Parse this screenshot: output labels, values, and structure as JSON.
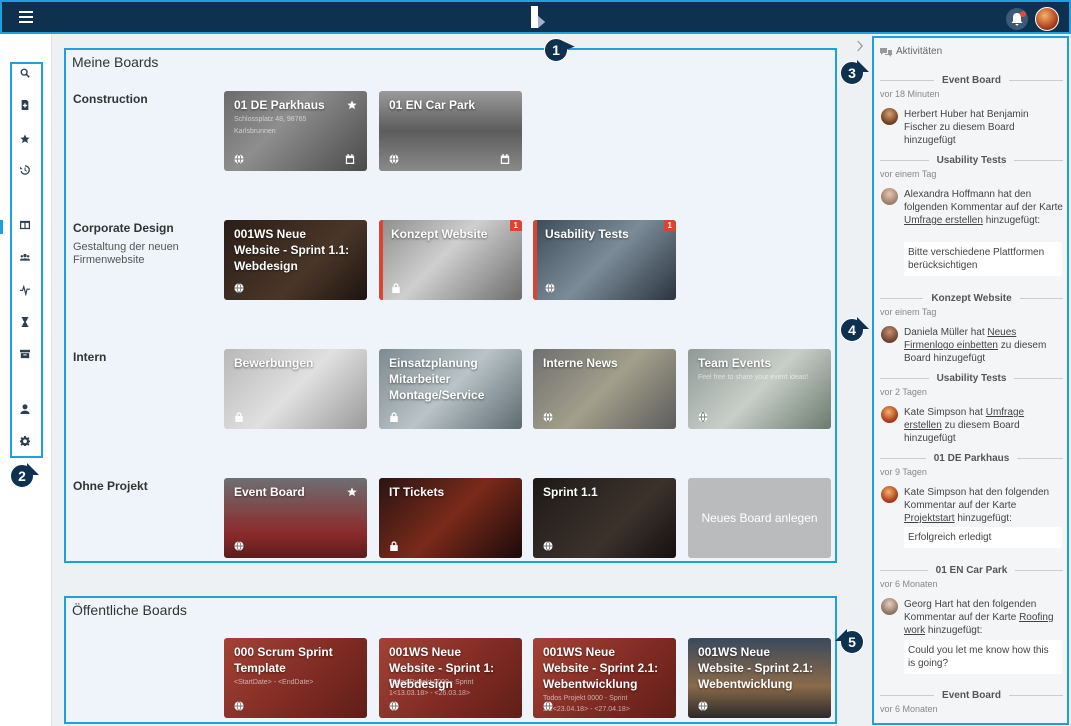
{
  "markers": [
    "1",
    "2",
    "3",
    "4",
    "5"
  ],
  "my_boards": {
    "title": "Meine Boards",
    "groups": [
      {
        "label": "Construction",
        "sub": ""
      },
      {
        "label": "Corporate Design",
        "sub": "Gestaltung der neuen Firmenwebsite"
      },
      {
        "label": "Intern",
        "sub": ""
      },
      {
        "label": "Ohne Projekt",
        "sub": ""
      }
    ],
    "cards": {
      "parkhaus": {
        "title": "01 DE Parkhaus",
        "sub1": "Schlossplatz 48, 98765",
        "sub2": "Karlsbrunnen"
      },
      "carpark": {
        "title": "01 EN Car Park"
      },
      "newsite": {
        "title": "001WS Neue Website - Sprint 1.1: Webdesign"
      },
      "konzept": {
        "title": "Konzept Website",
        "count": "1"
      },
      "usability": {
        "title": "Usability Tests",
        "count": "1"
      },
      "bewerbungen": {
        "title": "Bewerbungen"
      },
      "einsatz": {
        "title": "Einsatzplanung Mitarbeiter Montage/Service"
      },
      "news": {
        "title": "Interne News"
      },
      "team": {
        "title": "Team Events",
        "sub1": "Feel free to share your event ideas!"
      },
      "event": {
        "title": "Event Board"
      },
      "it": {
        "title": "IT Tickets"
      },
      "sprint": {
        "title": "Sprint 1.1"
      },
      "new_board": {
        "title": "Neues Board anlegen"
      }
    }
  },
  "public_boards": {
    "title": "Öffentliche Boards",
    "cards": {
      "scrum": {
        "title": "000 Scrum Sprint Template",
        "sub1": "<StartDate> - <EndDate>"
      },
      "ws1": {
        "title": "001WS Neue Website - Sprint 1: Webdesign",
        "sub1": "Todos Projekt 0000 - Sprint",
        "sub2": "1<13.03.18> - <26.03.18>"
      },
      "ws21a": {
        "title": "001WS Neue Website - Sprint 2.1: Webentwicklung",
        "sub1": "Todos Projekt 0000 - Sprint",
        "sub2": "2.1<23.04.18> - <27.04.18>"
      },
      "ws21b": {
        "title": "001WS Neue Website - Sprint 2.1: Webentwicklung"
      }
    }
  },
  "activities": {
    "title": "Aktivitäten",
    "entries": [
      {
        "board": "Event Board",
        "time": "vor 18 Minuten",
        "text": "Herbert Huber hat Benjamin Fischer zu diesem Board hinzugefügt"
      },
      {
        "board": "Usability Tests",
        "time": "vor einem Tag",
        "text_a": "Alexandra Hoffmann hat den folgenden Kommentar auf der Karte",
        "link": "Umfrage erstellen",
        "text_b": "hinzugefügt:",
        "quote": "Bitte verschiedene Plattformen berücksichtigen"
      },
      {
        "board": "Konzept Website",
        "time": "vor einem Tag",
        "text_a": "Daniela Müller hat",
        "link": "Neues Firmenlogo einbetten",
        "text_b": "zu diesem Board hinzugefügt"
      },
      {
        "board": "Usability Tests",
        "time": "vor 2 Tagen",
        "text_a": "Kate Simpson hat",
        "link": "Umfrage erstellen",
        "text_b": "zu diesem Board hinzugefügt"
      },
      {
        "board": "01 DE Parkhaus",
        "time": "vor 9 Tagen",
        "text_a": "Kate Simpson hat den folgenden Kommentar auf der Karte",
        "link": "Projektstart",
        "text_b": "hinzugefügt:",
        "quote": "Erfolgreich erledigt"
      },
      {
        "board": "01 EN Car Park",
        "time": "vor 6 Monaten",
        "text_a": "Georg Hart hat den folgenden Kommentar auf der Karte",
        "link": "Roofing work",
        "text_b": "hinzugefügt:",
        "quote": "Could you let me know how this is going?"
      },
      {
        "board": "Event Board",
        "time": "vor 6 Monaten"
      }
    ]
  },
  "icons": [
    "menu-icon",
    "logo-icon",
    "bell-icon",
    "search-icon",
    "new-board-icon",
    "star-icon",
    "history-icon",
    "boards-icon",
    "team-icon",
    "activity-icon",
    "hourglass-icon",
    "archive-icon",
    "user-icon",
    "gear-icon",
    "globe-icon",
    "lock-icon",
    "calendar-icon",
    "chevron-right-icon",
    "comments-icon"
  ],
  "colors": {
    "topbar": "#0f3150",
    "highlight": "#1ea0dd",
    "badge": "#0f3150",
    "count_badge": "#d9452f"
  }
}
